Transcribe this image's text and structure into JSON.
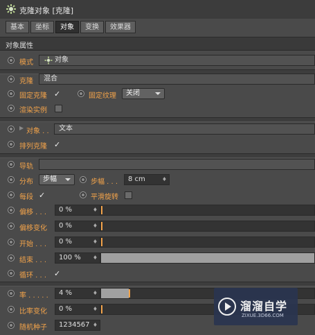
{
  "window": {
    "title": "克隆对象 [克隆]"
  },
  "tabs": [
    "基本",
    "坐标",
    "对象",
    "变换",
    "效果器"
  ],
  "active_tab": "对象",
  "section": {
    "title": "对象属性"
  },
  "mode": {
    "label": "模式",
    "value": "对象"
  },
  "clone": {
    "label": "克隆",
    "value": "混合"
  },
  "fixed_clone": {
    "label": "固定克隆",
    "checked": true
  },
  "fixed_texture": {
    "label": "固定纹理",
    "value": "关闭"
  },
  "render_instance": {
    "label": "渲染实例",
    "checked": false
  },
  "object": {
    "label": "对象 . .",
    "value": "文本"
  },
  "arrange_clone": {
    "label": "排列克隆",
    "checked": true
  },
  "rail": {
    "label": "导轨",
    "value": ""
  },
  "distribution": {
    "label": "分布",
    "value": "步幅"
  },
  "step": {
    "label": "步幅 . . .",
    "value": "8 cm"
  },
  "per_segment": {
    "label": "每段",
    "checked": true
  },
  "smooth_rotation": {
    "label": "平滑旋转",
    "checked": false
  },
  "offset": {
    "label": "偏移 . . .",
    "value": "0 %",
    "level": 0
  },
  "offset_variation": {
    "label": "偏移变化",
    "value": "0 %",
    "level": 0
  },
  "start": {
    "label": "开始 . . .",
    "value": "0 %",
    "level": 0
  },
  "end": {
    "label": "结束 . . .",
    "value": "100 %",
    "level": 1
  },
  "loop": {
    "label": "循环 . . .",
    "checked": true
  },
  "rate": {
    "label": "率 . . . . .",
    "value": "4 %",
    "level": 0.04
  },
  "rate_variation": {
    "label": "比率变化",
    "value": "0 %",
    "level": 0
  },
  "random_seed": {
    "label": "随机种子",
    "value": "1234567"
  },
  "watermark": {
    "name": "溜溜自学",
    "url": "ZIXUE.3D66.COM"
  },
  "check_glyph": "✓",
  "colors": {
    "label_orange": "#f2a34a",
    "panel_bg": "#4a4a4a",
    "field_bg": "#333333"
  }
}
